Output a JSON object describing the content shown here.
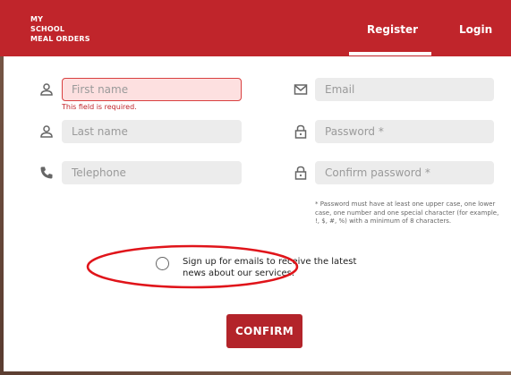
{
  "header": {
    "brand_lines": [
      "MY",
      "SCHOOL",
      "MEAL ORDERS"
    ],
    "nav": {
      "register": "Register",
      "login": "Login"
    },
    "bg_color": "#c0252b"
  },
  "form": {
    "first_name": {
      "placeholder": "First name",
      "icon": "person-icon",
      "error": "This field is required."
    },
    "last_name": {
      "placeholder": "Last name",
      "icon": "person-icon"
    },
    "telephone": {
      "placeholder": "Telephone",
      "icon": "phone-icon"
    },
    "email": {
      "placeholder": "Email",
      "icon": "envelope-icon"
    },
    "password": {
      "placeholder": "Password *",
      "icon": "lock-icon"
    },
    "confirm_password": {
      "placeholder": "Confirm password *",
      "icon": "lock-icon"
    },
    "password_hint": "* Password must have at least one upper case, one lower case, one number and one special character (for example, !, $, #, %) with a minimum of 8 characters.",
    "newsletter_label": "Sign up for emails to receive the latest news about our services.",
    "newsletter_checked": false,
    "confirm_label": "CONFIRM"
  },
  "colors": {
    "accent": "#c0252b",
    "error_bg": "#fde0e0",
    "field_bg": "#ececec",
    "annotation": "#e0141a"
  }
}
